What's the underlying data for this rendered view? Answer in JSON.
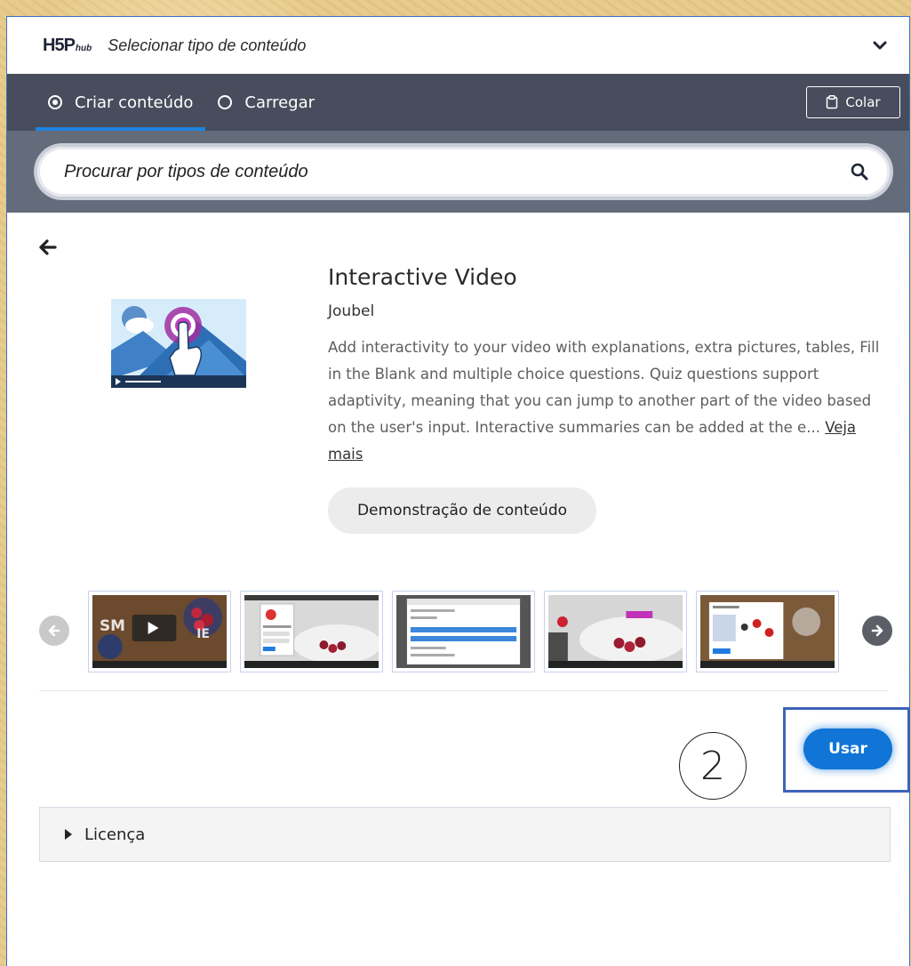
{
  "header": {
    "logo_main": "H5P",
    "logo_sub": "hub",
    "title": "Selecionar tipo de conteúdo"
  },
  "tabs": [
    {
      "label": "Criar conteúdo",
      "selected": true
    },
    {
      "label": "Carregar",
      "selected": false
    }
  ],
  "toolbar": {
    "paste_label": "Colar"
  },
  "search": {
    "placeholder": "Procurar por tipos de conteúdo"
  },
  "detail": {
    "title": "Interactive Video",
    "owner": "Joubel",
    "description": "Add interactivity to your video with explanations, extra pictures, tables, Fill in the Blank and multiple choice questions. Quiz questions support adaptivity, meaning that you can jump to another part of the video based on the user's input. Interactive summaries can be added at the e...",
    "read_more": "Veja mais",
    "demo_label": "Demonstração de conteúdo"
  },
  "screenshots": [
    {
      "name": "screenshot-1"
    },
    {
      "name": "screenshot-2"
    },
    {
      "name": "screenshot-3"
    },
    {
      "name": "screenshot-4"
    },
    {
      "name": "screenshot-5"
    }
  ],
  "actions": {
    "use_label": "Usar",
    "step_number": "2"
  },
  "license": {
    "label": "Licença"
  },
  "colors": {
    "accent": "#1075d6",
    "tabbar": "#474d5c",
    "searchbar": "#646b7a",
    "highlight_border": "#3e63b8"
  }
}
